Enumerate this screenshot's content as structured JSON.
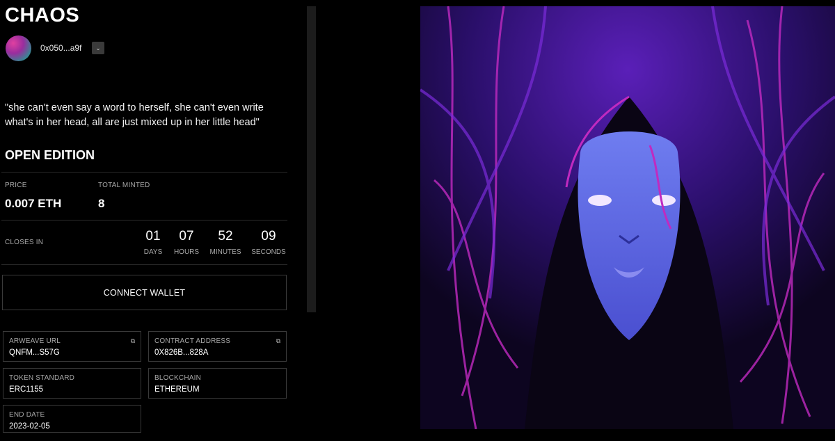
{
  "title": "CHAOS",
  "creator": {
    "address": "0x050...a9f",
    "dropdown_icon": "chevron-down-icon"
  },
  "description": "\"she can't even say a word to herself, she can't even write what's in her head, all are just mixed up in her little head\"",
  "edition_type": "OPEN EDITION",
  "price": {
    "label": "PRICE",
    "value": "0.007 ETH"
  },
  "total_minted": {
    "label": "TOTAL MINTED",
    "value": "8"
  },
  "closes_in": {
    "label": "CLOSES IN",
    "days": {
      "value": "01",
      "label": "DAYS"
    },
    "hours": {
      "value": "07",
      "label": "HOURS"
    },
    "minutes": {
      "value": "52",
      "label": "MINUTES"
    },
    "seconds": {
      "value": "09",
      "label": "SECONDS"
    }
  },
  "connect_wallet": "CONNECT WALLET",
  "details": {
    "arweave": {
      "label": "ARWEAVE URL",
      "value": "QNFM...S57G"
    },
    "contract": {
      "label": "CONTRACT ADDRESS",
      "value": "0X826B...828A"
    },
    "token_standard": {
      "label": "TOKEN STANDARD",
      "value": "ERC1155"
    },
    "blockchain": {
      "label": "BLOCKCHAIN",
      "value": "ETHEREUM"
    },
    "end_date": {
      "label": "END DATE",
      "value": "2023-02-05"
    }
  },
  "colors": {
    "background": "#000000",
    "accent_purple": "#7a2bd8",
    "accent_magenta": "#c02ac0"
  }
}
